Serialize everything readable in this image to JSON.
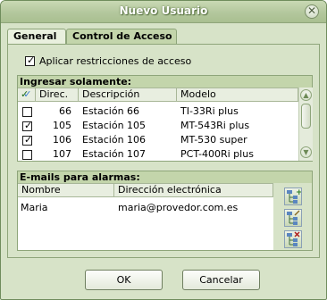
{
  "window": {
    "title": "Nuevo Usuario",
    "close_glyph": "✕"
  },
  "tabs": [
    {
      "label": "General",
      "selected": false
    },
    {
      "label": "Control de Acceso",
      "selected": true
    }
  ],
  "restrict": {
    "label": "Aplicar restricciones de acceso",
    "checked": true
  },
  "access_list": {
    "header": "Ingresar solamente:",
    "columns": [
      "",
      "Direc.",
      "Descripción",
      "Modelo"
    ],
    "rows": [
      {
        "checked": false,
        "dir": "66",
        "desc": "Estación 66",
        "model": "TI-33Ri plus"
      },
      {
        "checked": true,
        "dir": "105",
        "desc": "Estación 105",
        "model": "MT-543Ri plus"
      },
      {
        "checked": true,
        "dir": "106",
        "desc": "Estación 106",
        "model": "MT-530 super"
      },
      {
        "checked": false,
        "dir": "107",
        "desc": "Estación 107",
        "model": "PCT-400Ri plus"
      }
    ]
  },
  "emails": {
    "header": "E-mails para alarmas:",
    "columns": [
      "Nombre",
      "Dirección electrónica"
    ],
    "rows": [
      {
        "name": "Maria",
        "email": "maria@provedor.com.es"
      }
    ],
    "side_buttons": [
      "add-email-icon",
      "edit-email-icon",
      "remove-email-icon"
    ]
  },
  "buttons": {
    "ok": "OK",
    "cancel": "Cancelar"
  },
  "glyphs": {
    "check": "✓",
    "up": "▲",
    "down": "▼"
  }
}
